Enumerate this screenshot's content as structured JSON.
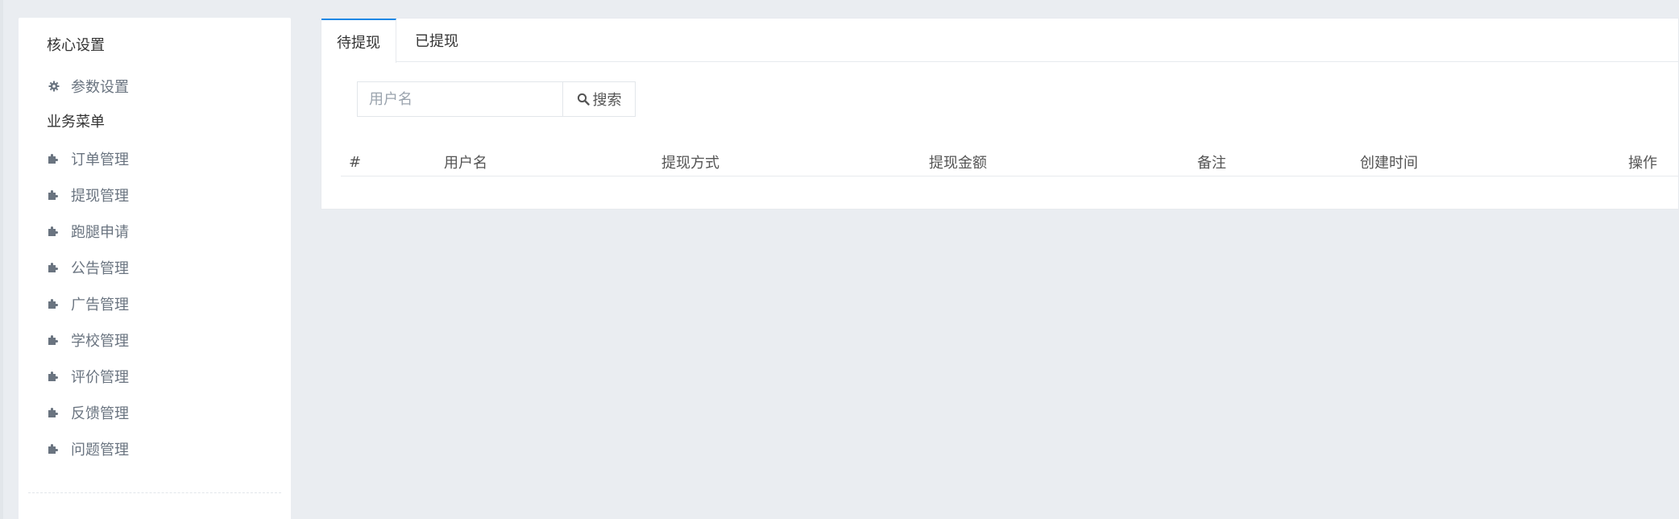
{
  "sidebar": {
    "core_title": "核心设置",
    "core_items": [
      {
        "label": "参数设置",
        "icon": "gear-icon"
      }
    ],
    "business_title": "业务菜单",
    "business_items": [
      {
        "label": "订单管理",
        "icon": "puzzle-icon"
      },
      {
        "label": "提现管理",
        "icon": "puzzle-icon"
      },
      {
        "label": "跑腿申请",
        "icon": "puzzle-icon"
      },
      {
        "label": "公告管理",
        "icon": "puzzle-icon"
      },
      {
        "label": "广告管理",
        "icon": "puzzle-icon"
      },
      {
        "label": "学校管理",
        "icon": "puzzle-icon"
      },
      {
        "label": "评价管理",
        "icon": "puzzle-icon"
      },
      {
        "label": "反馈管理",
        "icon": "puzzle-icon"
      },
      {
        "label": "问题管理",
        "icon": "puzzle-icon"
      }
    ]
  },
  "tabs": [
    {
      "label": "待提现",
      "active": true
    },
    {
      "label": "已提现",
      "active": false
    }
  ],
  "search": {
    "placeholder": "用户名",
    "value": "",
    "button_label": "搜索",
    "button_icon": "search-icon"
  },
  "table": {
    "columns": [
      "#",
      "用户名",
      "提现方式",
      "提现金额",
      "备注",
      "创建时间",
      "操作"
    ],
    "rows": []
  },
  "colors": {
    "background": "#eaedf1",
    "panel": "#ffffff",
    "accent": "#1e88e5",
    "muted_text": "#6a7480"
  }
}
